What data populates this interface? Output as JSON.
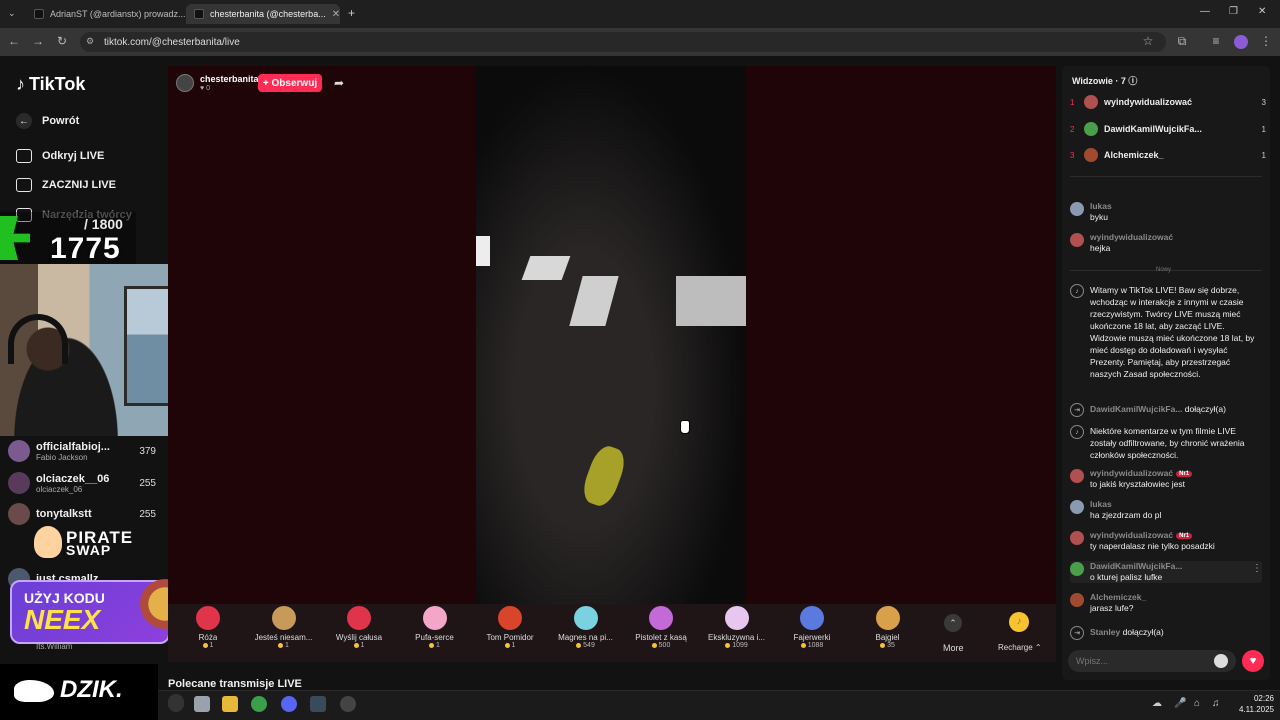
{
  "browser": {
    "tabs": [
      {
        "label": "AdrianST (@ardianstx) prowadz..."
      },
      {
        "label": "chesterbanita (@chesterba..."
      }
    ],
    "url": "tiktok.com/@chesterbanita/live",
    "new_tab": "+"
  },
  "sidebar": {
    "logo": "TikTok",
    "back": "Powrót",
    "items": [
      {
        "label": "Odkryj LIVE"
      },
      {
        "label": "ZACZNIJ LIVE"
      },
      {
        "label": "Narzędzia twórcy"
      }
    ]
  },
  "overlay": {
    "counter_total": "/ 1800",
    "counter_value": "1775",
    "ranking": [
      {
        "name": "officialfabioj...",
        "sub": "Fabio Jackson",
        "score": "379"
      },
      {
        "name": "olciaczek__06",
        "sub": "olciaczek_06",
        "score": "255"
      },
      {
        "name": "tonytalkstt",
        "sub": "",
        "score": "255"
      },
      {
        "name": "just.csmallz",
        "sub": "",
        "score": ""
      },
      {
        "name": "",
        "sub": "Its.William",
        "score": ""
      }
    ],
    "pirate_line1": "PIRATE",
    "pirate_line2": "SWAP",
    "neex_line1": "UŻYJ KODU",
    "neex_line2": "NEEX",
    "dzik": "DZIK."
  },
  "stream": {
    "host_name": "chesterbanita",
    "host_likes": "♥ 0",
    "follow_label": "+ Obserwuj"
  },
  "gifts": [
    {
      "name": "Róża",
      "price": "1",
      "color": "#e0344a"
    },
    {
      "name": "Jesteś niesam...",
      "price": "1",
      "color": "#c89a5a"
    },
    {
      "name": "Wyślij całusa",
      "price": "1",
      "color": "#e0344a"
    },
    {
      "name": "Pufa-serce",
      "price": "1",
      "color": "#f4a6c8"
    },
    {
      "name": "Tom Pomidor",
      "price": "1",
      "color": "#d8452a"
    },
    {
      "name": "Magnes na pi...",
      "price": "549",
      "color": "#7ad1e0"
    },
    {
      "name": "Pistolet z kasą",
      "price": "500",
      "color": "#c46ad8"
    },
    {
      "name": "Ekskluzywna i...",
      "price": "1099",
      "color": "#e7c6f0"
    },
    {
      "name": "Fajerwerki",
      "price": "1088",
      "color": "#5a7ae0"
    },
    {
      "name": "Bajgiel",
      "price": "35",
      "color": "#d8a04a"
    }
  ],
  "gift_more": "More",
  "recharge": "Recharge ⌃",
  "polecane": "Polecane transmisje LIVE",
  "chat": {
    "header": "Widzowie · 7 ⓘ",
    "top_viewers": [
      {
        "rank": "1",
        "name": "wyindywidualizować",
        "score": "3",
        "color": "#b05050"
      },
      {
        "rank": "2",
        "name": "DawidKamilWujcikFa...",
        "score": "1",
        "color": "#4aa04a"
      },
      {
        "rank": "3",
        "name": "Alchemiczek_",
        "score": "1",
        "color": "#a04a30"
      }
    ],
    "nowy": "Nowy",
    "messages": [
      {
        "user": "lukas",
        "text": "byku",
        "badge": ""
      },
      {
        "user": "wyindywidualizować",
        "text": "hejka",
        "badge": ""
      },
      {
        "user": "",
        "text": "Witamy w TikTok LIVE! Baw się dobrze, wchodząc w interakcje z innymi w czasie rzeczywistym. Twórcy LIVE muszą mieć ukończone 18 lat, aby zacząć LIVE. Widzowie muszą mieć ukończone 18 lat, by mieć dostęp do doładowań i wysyłać Prezenty. Pamiętaj, aby przestrzegać naszych Zasad społeczności.",
        "badge": ""
      },
      {
        "user": "DawidKamilWujcikFa...",
        "text": "dołączył(a)",
        "badge": ""
      },
      {
        "user": "",
        "text": "Niektóre komentarze w tym filmie LIVE zostały odfiltrowane, by chronić wrażenia członków społeczności.",
        "badge": ""
      },
      {
        "user": "wyindywidualizować",
        "text": "to jakiś kryształowiec jest",
        "badge": "Nr1"
      },
      {
        "user": "lukas",
        "text": "ha zjezdrzam do pl",
        "badge": ""
      },
      {
        "user": "wyindywidualizować",
        "text": "ty naperdalasz nie tylko posadzki",
        "badge": "Nr1"
      },
      {
        "user": "DawidKamilWujcikFa...",
        "text": "o kturej palisz lufke",
        "badge": ""
      },
      {
        "user": "Alchemiczek_",
        "text": "jarasz lufe?",
        "badge": ""
      },
      {
        "user": "Stanley",
        "text": "dołączył(a)",
        "badge": ""
      }
    ],
    "input_placeholder": "Wpisz..."
  },
  "taskbar": {
    "time": "02:26",
    "date": "4.11.2025"
  },
  "colors": {
    "accent": "#fe2c55",
    "stream_bg": "#1f0508",
    "coin": "#f7c331"
  }
}
